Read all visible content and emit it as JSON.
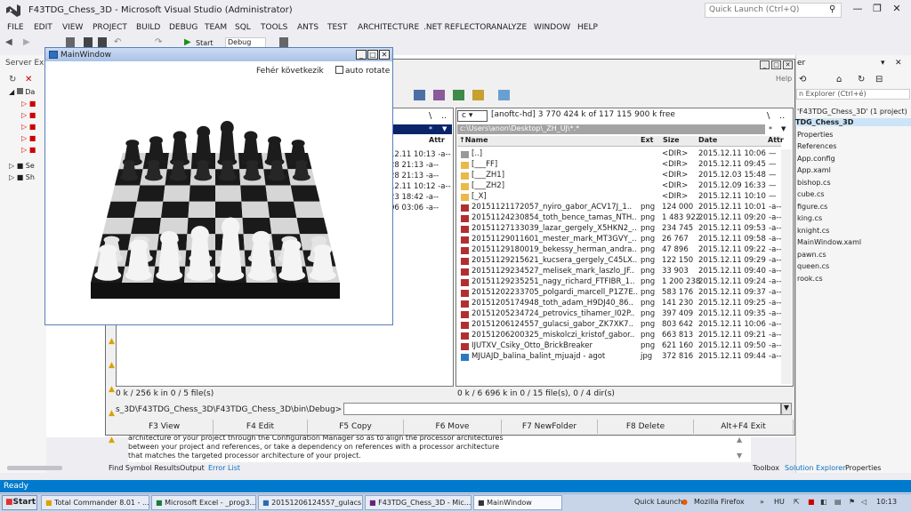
{
  "vs": {
    "title": "F43TDG_Chess_3D - Microsoft Visual Studio (Administrator)",
    "quick_launch_placeholder": "Quick Launch (Ctrl+Q)",
    "menu": [
      "FILE",
      "EDIT",
      "VIEW",
      "PROJECT",
      "BUILD",
      "DEBUG",
      "TEAM",
      "SQL",
      "TOOLS",
      "ANTS",
      "TEST",
      "ARCHITECTURE",
      ".NET REFLECTOR",
      "ANALYZE",
      "WINDOW",
      "HELP"
    ],
    "start_label": "Start",
    "config_label": "Debug",
    "server_explorer_title": "Server Explo",
    "server_tree": [
      "Da",
      "",
      "",
      "",
      "",
      "",
      "Se",
      "Sh"
    ],
    "solution_explorer": {
      "title": "er",
      "search_placeholder": "n Explorer (Ctrl+é)",
      "items": [
        "'F43TDG_Chess_3D' (1 project)",
        "TDG_Chess_3D",
        "Properties",
        "References",
        "App.config",
        "App.xaml",
        "bishop.cs",
        "cube.cs",
        "figure.cs",
        "king.cs",
        "knight.cs",
        "MainWindow.xaml",
        "pawn.cs",
        "queen.cs",
        "rook.cs"
      ]
    },
    "output_text": [
      "architecture of your project through the Configuration Manager so as to align the processor architectures",
      "between your project and references, or take a dependency on references with a processor architecture",
      "that matches the targeted processor architecture of your project."
    ],
    "bottom_tabs": [
      "Find Symbol Results",
      "Output",
      "Error List"
    ],
    "right_tabs": [
      "Toolbox",
      "Solution Explorer",
      "Properties"
    ],
    "status": "Ready"
  },
  "taskbar": {
    "start": "Start",
    "tasks": [
      "Total Commander 8.01 - ...",
      "Microsoft Excel - _prog3...",
      "20151206124557_gulacs...",
      "F43TDG_Chess_3D - Mic...",
      "MainWindow"
    ],
    "quick_launch": "Quick Launch",
    "firefox": "Mozilla Firefox",
    "lang": "HU",
    "time": "10:13"
  },
  "tc": {
    "help_label": "Help",
    "left_drive": "c",
    "right_drive": "c",
    "right_drive_info": "[anoftc-hd]  3 770 424 k of 117 115 900 k free",
    "right_path": "c:\\Users\\anon\\Desktop\\_ZH_UJ\\*.*",
    "columns": {
      "name": "Name",
      "ext": "Ext",
      "size": "Size",
      "date": "Date",
      "attr": "Attr"
    },
    "left_attr_header": "Attr",
    "left_rows": [
      {
        "date": "12.11 10:13",
        "attr": "-a--"
      },
      {
        "date": "28 21:13",
        "attr": "-a--"
      },
      {
        "date": "28 21:13",
        "attr": "-a--"
      },
      {
        "date": "12.11 10:12",
        "attr": "-a--"
      },
      {
        "date": "23 18:42",
        "attr": "-a--"
      },
      {
        "date": "06 03:06",
        "attr": "-a--"
      }
    ],
    "files": [
      {
        "name": "[..]",
        "ext": "",
        "size": "<DIR>",
        "date": "2015.12.11 10:06",
        "attr": "—",
        "type": "up"
      },
      {
        "name": "[___FF]",
        "ext": "",
        "size": "<DIR>",
        "date": "2015.12.11 09:45",
        "attr": "—",
        "type": "dir"
      },
      {
        "name": "[___ZH1]",
        "ext": "",
        "size": "<DIR>",
        "date": "2015.12.03 15:48",
        "attr": "—",
        "type": "dir"
      },
      {
        "name": "[___ZH2]",
        "ext": "",
        "size": "<DIR>",
        "date": "2015.12.09 16:33",
        "attr": "—",
        "type": "dir"
      },
      {
        "name": "[_X]",
        "ext": "",
        "size": "<DIR>",
        "date": "2015.12.11 10:10",
        "attr": "—",
        "type": "dir"
      },
      {
        "name": "20151121172057_nyiro_gabor_ACV17J_1..",
        "ext": "png",
        "size": "124 000",
        "date": "2015.12.11 10:01",
        "attr": "-a--",
        "type": "png"
      },
      {
        "name": "20151124230854_toth_bence_tamas_NTH..",
        "ext": "png",
        "size": "1 483 922",
        "date": "2015.12.11 09:20",
        "attr": "-a--",
        "type": "png"
      },
      {
        "name": "20151127133039_lazar_gergely_X5HKN2_..",
        "ext": "png",
        "size": "234 745",
        "date": "2015.12.11 09:53",
        "attr": "-a--",
        "type": "png"
      },
      {
        "name": "20151129011601_mester_mark_MT3GVY_..",
        "ext": "png",
        "size": "26 767",
        "date": "2015.12.11 09:58",
        "attr": "-a--",
        "type": "png"
      },
      {
        "name": "20151129180019_bekessy_herman_andra..",
        "ext": "png",
        "size": "47 896",
        "date": "2015.12.11 09:22",
        "attr": "-a--",
        "type": "png"
      },
      {
        "name": "20151129215621_kucsera_gergely_C45LX..",
        "ext": "png",
        "size": "122 150",
        "date": "2015.12.11 09:29",
        "attr": "-a--",
        "type": "png"
      },
      {
        "name": "20151129234527_melisek_mark_laszlo_JF..",
        "ext": "png",
        "size": "33 903",
        "date": "2015.12.11 09:40",
        "attr": "-a--",
        "type": "png"
      },
      {
        "name": "20151129235251_nagy_richard_FTFIBR_1..",
        "ext": "png",
        "size": "1 200 238",
        "date": "2015.12.11 09:24",
        "attr": "-a--",
        "type": "png"
      },
      {
        "name": "20151202233705_polgardi_marcell_P1Z7E..",
        "ext": "png",
        "size": "583 176",
        "date": "2015.12.11 09:37",
        "attr": "-a--",
        "type": "png"
      },
      {
        "name": "20151205174948_toth_adam_H9DJ40_86..",
        "ext": "png",
        "size": "141 230",
        "date": "2015.12.11 09:25",
        "attr": "-a--",
        "type": "png"
      },
      {
        "name": "20151205234724_petrovics_tihamer_I02P..",
        "ext": "png",
        "size": "397 409",
        "date": "2015.12.11 09:35",
        "attr": "-a--",
        "type": "png"
      },
      {
        "name": "20151206124557_gulacsi_gabor_ZK7XK7..",
        "ext": "png",
        "size": "803 642",
        "date": "2015.12.11 10:06",
        "attr": "-a--",
        "type": "png"
      },
      {
        "name": "20151206200325_miskolczi_kristof_gabor..",
        "ext": "png",
        "size": "663 813",
        "date": "2015.12.11 09:21",
        "attr": "-a--",
        "type": "png"
      },
      {
        "name": "IJUTXV_Csiky_Otto_BrickBreaker",
        "ext": "png",
        "size": "621 160",
        "date": "2015.12.11 09:50",
        "attr": "-a--",
        "type": "png"
      },
      {
        "name": "MJUAJD_balina_balint_mjuajd - agot",
        "ext": "jpg",
        "size": "372 816",
        "date": "2015.12.11 09:44",
        "attr": "-a--",
        "type": "jpg"
      }
    ],
    "left_status": "0 k / 256 k in 0 / 5 file(s)",
    "right_status": "0 k / 6 696 k in 0 / 15 file(s), 0 / 4 dir(s)",
    "cmd_path": "s_3D\\F43TDG_Chess_3D\\F43TDG_Chess_3D\\bin\\Debug>",
    "fkeys": [
      "F3 View",
      "F4 Edit",
      "F5 Copy",
      "F6 Move",
      "F7 NewFolder",
      "F8 Delete",
      "Alt+F4 Exit"
    ]
  },
  "main_window": {
    "title": "MainWindow",
    "next_move": "Fehér következik",
    "auto_rotate": "auto rotate",
    "auto_rotate_checked": false
  },
  "colors": {
    "vs_accent": "#007acc",
    "selection": "#3399ff"
  }
}
